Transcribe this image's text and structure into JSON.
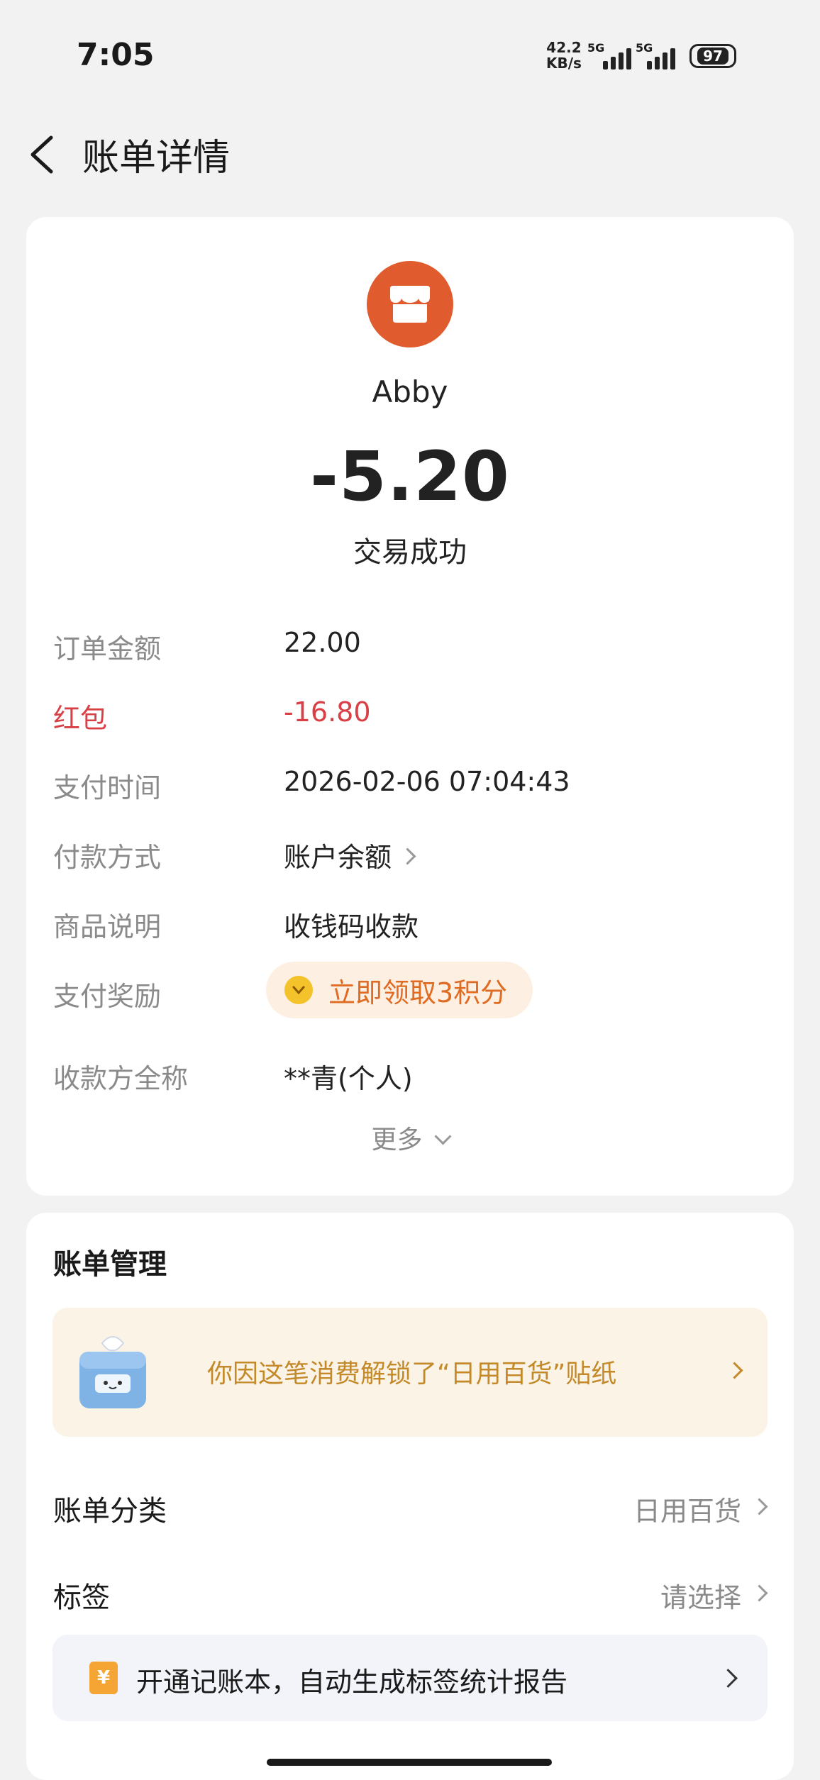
{
  "status_bar": {
    "time": "7:05",
    "net_speed_value": "42.2",
    "net_speed_unit": "KB/s",
    "sim1_label": "5G",
    "sim2_label": "5G",
    "battery": "97"
  },
  "header": {
    "title": "账单详情"
  },
  "transaction": {
    "merchant": "Abby",
    "amount": "-5.20",
    "status": "交易成功",
    "accent_color": "#e05c2e"
  },
  "details": [
    {
      "key": "订单金额",
      "value": "22.00"
    },
    {
      "key": "红包",
      "value": "-16.80"
    },
    {
      "key": "支付时间",
      "value": "2026-02-06 07:04:43"
    },
    {
      "key": "付款方式",
      "value": "账户余额"
    },
    {
      "key": "商品说明",
      "value": "收钱码收款"
    },
    {
      "key": "支付奖励",
      "value": "立即领取3积分"
    },
    {
      "key": "收款方全称",
      "value": "**青(个人)"
    }
  ],
  "more_label": "更多",
  "management": {
    "title": "账单管理",
    "sticker_text": "你因这笔消费解锁了“日用百货”贴纸",
    "category_label": "账单分类",
    "category_value": "日用百货",
    "tag_label": "标签",
    "tag_value": "请选择",
    "promo_icon": "¥",
    "promo_text": "开通记账本，自动生成标签统计报告"
  }
}
